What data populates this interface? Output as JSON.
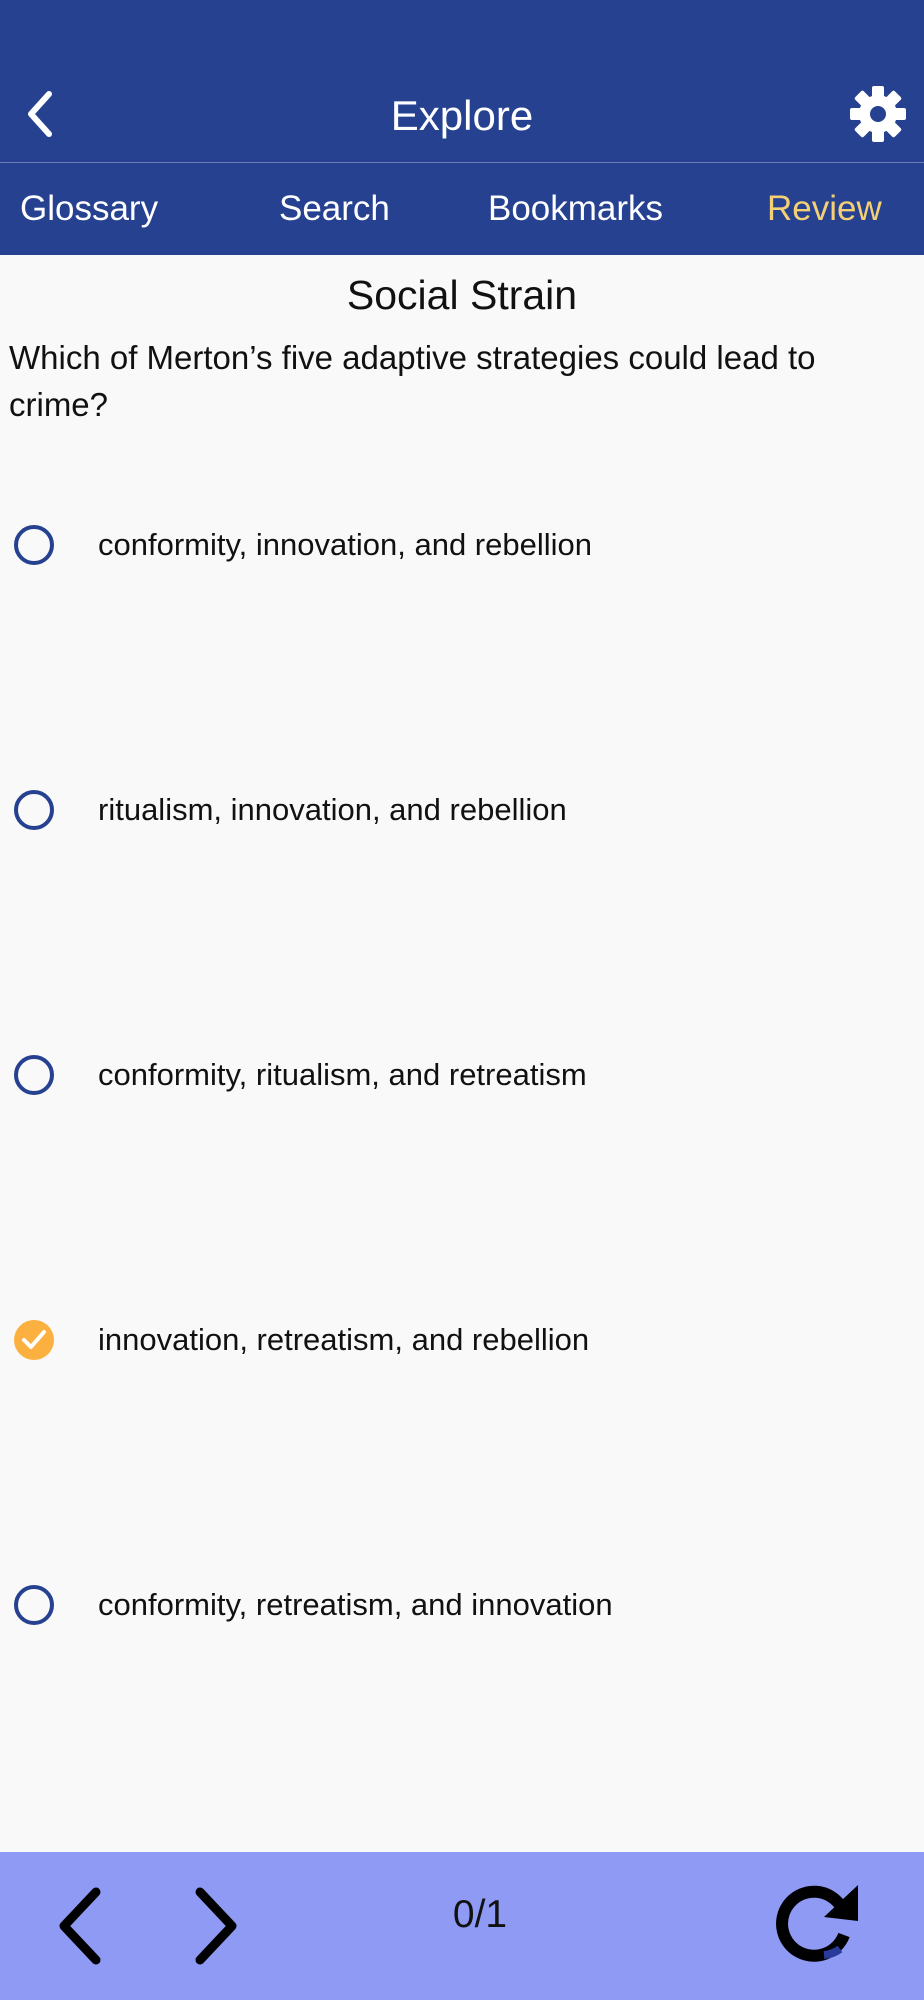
{
  "header": {
    "title": "Explore",
    "back_icon": "chevron-left-icon",
    "settings_icon": "gear-icon"
  },
  "tabs": [
    {
      "label": "Glossary",
      "active": false
    },
    {
      "label": "Search",
      "active": false
    },
    {
      "label": "Bookmarks",
      "active": false
    },
    {
      "label": "Review",
      "active": true
    }
  ],
  "quiz": {
    "title": "Social Strain",
    "question": "Which of Merton’s five adaptive strategies could lead to crime?",
    "options": [
      {
        "label": "conformity, innovation, and rebellion",
        "selected": false
      },
      {
        "label": "ritualism, innovation, and rebellion",
        "selected": false
      },
      {
        "label": "conformity, ritualism, and retreatism",
        "selected": false
      },
      {
        "label": "innovation, retreatism, and rebellion",
        "selected": true
      },
      {
        "label": "conformity, retreatism, and innovation",
        "selected": false
      }
    ]
  },
  "footer": {
    "counter": "0/1",
    "prev_icon": "chevron-left-icon",
    "next_icon": "chevron-right-icon",
    "refresh_icon": "refresh-icon"
  },
  "colors": {
    "header_bg": "#254190",
    "active_tab": "#f3cf75",
    "radio_border": "#254190",
    "selected_radio": "#fbb040",
    "footer_bg": "#8f9af4"
  }
}
